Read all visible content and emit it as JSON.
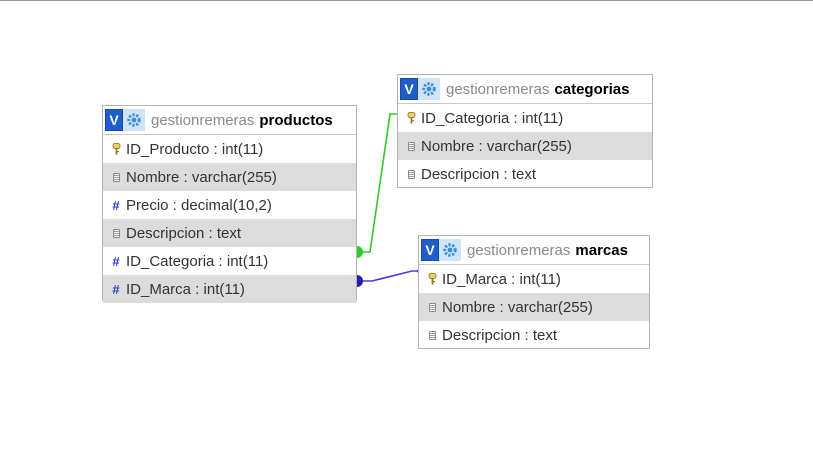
{
  "tables": {
    "productos": {
      "db": "gestionremeras",
      "name": "productos",
      "columns": [
        {
          "text": "ID_Producto : int(11)",
          "icon": "key-icon"
        },
        {
          "text": "Nombre : varchar(255)",
          "icon": "text-field-icon"
        },
        {
          "text": "Precio : decimal(10,2)",
          "icon": "numeric-field-icon"
        },
        {
          "text": "Descripcion : text",
          "icon": "text-field-icon"
        },
        {
          "text": "ID_Categoria : int(11)",
          "icon": "numeric-field-icon"
        },
        {
          "text": "ID_Marca : int(11)",
          "icon": "numeric-field-icon"
        }
      ]
    },
    "categorias": {
      "db": "gestionremeras",
      "name": "categorias",
      "columns": [
        {
          "text": "ID_Categoria : int(11)",
          "icon": "key-icon"
        },
        {
          "text": "Nombre : varchar(255)",
          "icon": "text-field-icon"
        },
        {
          "text": "Descripcion : text",
          "icon": "text-field-icon"
        }
      ]
    },
    "marcas": {
      "db": "gestionremeras",
      "name": "marcas",
      "columns": [
        {
          "text": "ID_Marca : int(11)",
          "icon": "key-icon"
        },
        {
          "text": "Nombre : varchar(255)",
          "icon": "text-field-icon"
        },
        {
          "text": "Descripcion : text",
          "icon": "text-field-icon"
        }
      ]
    }
  },
  "common": {
    "toggle_label": "V",
    "toggle_icon": "toggle-v-icon",
    "options_icon": "gear-icon"
  },
  "relations": [
    {
      "from": "productos.ID_Categoria",
      "to": "categorias.ID_Categoria",
      "color": "#2ecc2e"
    },
    {
      "from": "productos.ID_Marca",
      "to": "marcas.ID_Marca",
      "color": "#4040d8"
    }
  ],
  "colors": {
    "header_v": "#1f5ec8",
    "row_alt": "#dcdcdc",
    "relation_categoria": "#2ecc2e",
    "relation_marca": "#4040d8"
  }
}
